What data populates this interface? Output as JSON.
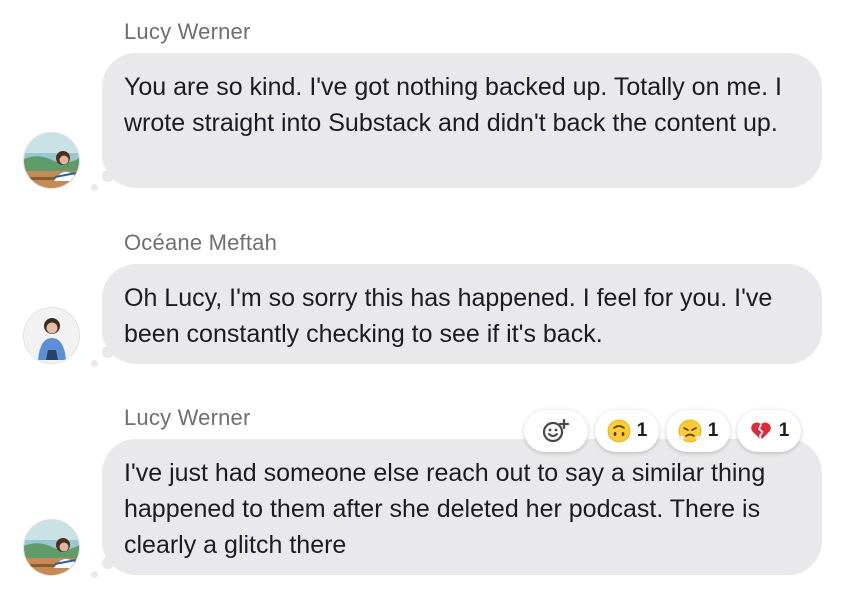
{
  "messages": [
    {
      "sender": "Lucy Werner",
      "text": "You are so kind. I've got nothing backed up. Totally on me. I wrote straight into Substack and didn't back the content up."
    },
    {
      "sender": "Océane Meftah",
      "text": "Oh Lucy, I'm so sorry this has happened. I feel for you. I've been constantly checking to see if it's back."
    },
    {
      "sender": "Lucy Werner",
      "text": "I've just had someone else reach out to say a similar thing happened to them after she deleted her podcast. There is clearly a glitch there"
    }
  ],
  "reactions": {
    "add_icon": "add-reaction-icon",
    "items": [
      {
        "icon": "upside-down-face-emoji",
        "count": "1"
      },
      {
        "icon": "face-with-steam-emoji",
        "count": "1"
      },
      {
        "icon": "broken-heart-emoji",
        "count": "1"
      }
    ]
  },
  "colors": {
    "bubble": "#e9e9eb",
    "sender_name": "#6e6e73",
    "message_text": "#1c1c1e"
  }
}
